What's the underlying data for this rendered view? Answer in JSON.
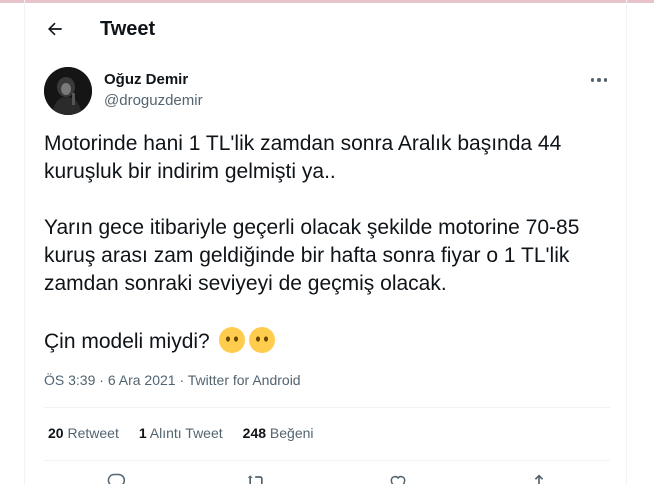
{
  "header": {
    "title": "Tweet"
  },
  "tweet": {
    "author_name": "Oğuz Demir",
    "author_handle": "@droguzdemir",
    "text_line_1": "Motorinde hani 1 TL'lik zamdan sonra Aralık başında 44 kuruşluk bir indirim gelmişti ya..",
    "text_line_2": "Yarın gece itibariyle geçerli olacak şekilde motorine 70-85 kuruş arası zam geldiğinde bir hafta sonra fiyar o 1 TL'lik zamdan sonraki seviyeyi de geçmiş olacak.",
    "text_line_3": "Çin modeli miydi?",
    "time": "ÖS 3:39",
    "date": "6 Ara 2021",
    "source": "Twitter for Android",
    "separator": "·"
  },
  "stats": {
    "retweets_count": "20",
    "retweets_label": "Retweet",
    "quotes_count": "1",
    "quotes_label": "Alıntı Tweet",
    "likes_count": "248",
    "likes_label": "Beğeni"
  },
  "icons": {
    "back": "arrow-left-icon",
    "more": "more-horizontal-icon",
    "emoji": "face-without-mouth-emoji",
    "reply": "reply-icon",
    "retweet": "retweet-icon",
    "like": "heart-icon",
    "share": "share-icon"
  },
  "colors": {
    "text_primary": "#0f1419",
    "text_secondary": "#536471",
    "border": "#eff3f4",
    "emoji_yellow": "#ffcc4d"
  }
}
